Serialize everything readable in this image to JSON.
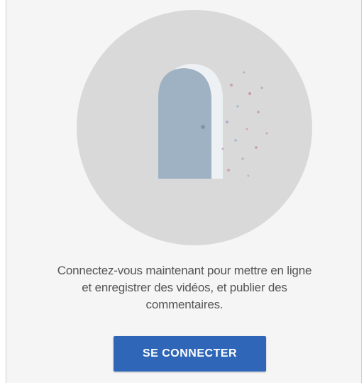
{
  "message": {
    "line1": "Connectez-vous maintenant pour mettre en ligne",
    "line2": "et enregistrer des vidéos, et publier des",
    "line3": "commentaires."
  },
  "signin_button": {
    "label": "SE CONNECTER"
  },
  "illustration": {
    "icon": "door-icon"
  },
  "colors": {
    "button": "#2f66b8",
    "circle": "#d9d9d9",
    "door": "#9fb2c3",
    "text": "#555555"
  }
}
